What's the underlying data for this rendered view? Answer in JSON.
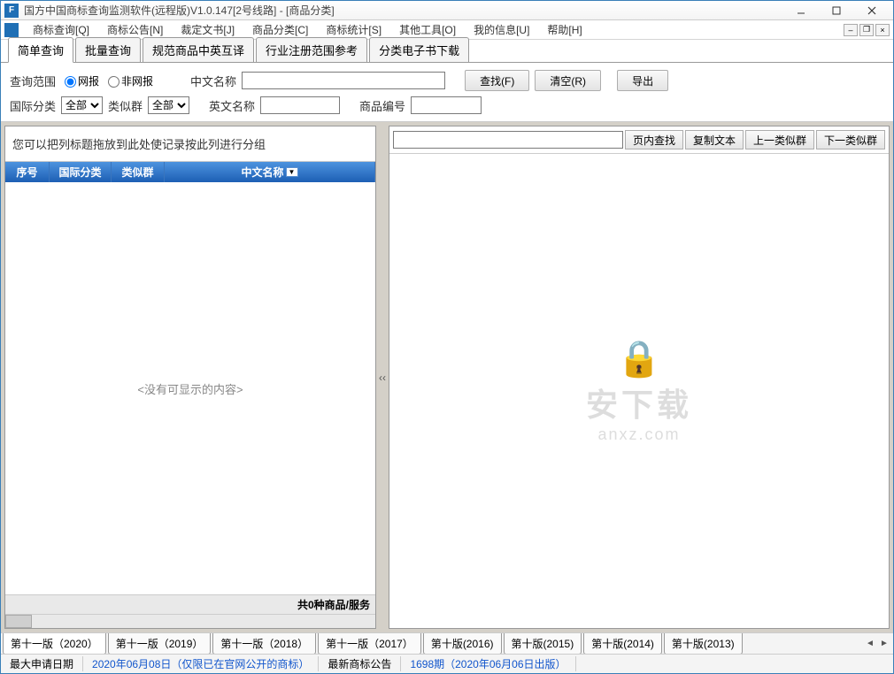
{
  "titlebar": {
    "title": "国方中国商标查询监测软件(远程版)V1.0.147[2号线路] - [商品分类]"
  },
  "menubar": {
    "items": [
      "商标查询[Q]",
      "商标公告[N]",
      "裁定文书[J]",
      "商品分类[C]",
      "商标统计[S]",
      "其他工具[O]",
      "我的信息[U]",
      "帮助[H]"
    ]
  },
  "tabs": {
    "items": [
      "简单查询",
      "批量查询",
      "规范商品中英互译",
      "行业注册范围参考",
      "分类电子书下载"
    ],
    "active": 0
  },
  "filter": {
    "scope_label": "查询范围",
    "radio_web": "网报",
    "radio_nonweb": "非网报",
    "cn_name_label": "中文名称",
    "intl_class_label": "国际分类",
    "intl_class_value": "全部",
    "similar_group_label": "类似群",
    "similar_group_value": "全部",
    "en_name_label": "英文名称",
    "goods_code_label": "商品编号",
    "btn_search": "查找(F)",
    "btn_clear": "清空(R)",
    "btn_export": "导出"
  },
  "grid": {
    "group_hint": "您可以把列标题拖放到此处使记录按此列进行分组",
    "cols": [
      "序号",
      "国际分类",
      "类似群",
      "中文名称"
    ],
    "empty": "<没有可显示的内容>",
    "footer": "共0种商品/服务"
  },
  "right": {
    "btn_find": "页内查找",
    "btn_copy": "复制文本",
    "btn_prev": "上一类似群",
    "btn_next": "下一类似群"
  },
  "versions": {
    "items": [
      "第十一版（2020）",
      "第十一版（2019）",
      "第十一版（2018）",
      "第十一版（2017）",
      "第十版(2016)",
      "第十版(2015)",
      "第十版(2014)",
      "第十版(2013)"
    ],
    "active": 0
  },
  "status": {
    "max_date_label": "最大申请日期",
    "max_date_value": "2020年06月08日（仅限已在官网公开的商标）",
    "latest_label": "最新商标公告",
    "latest_value": "1698期（2020年06月06日出版）"
  },
  "watermark": {
    "t1": "安下载",
    "t2": "anxz.com"
  }
}
